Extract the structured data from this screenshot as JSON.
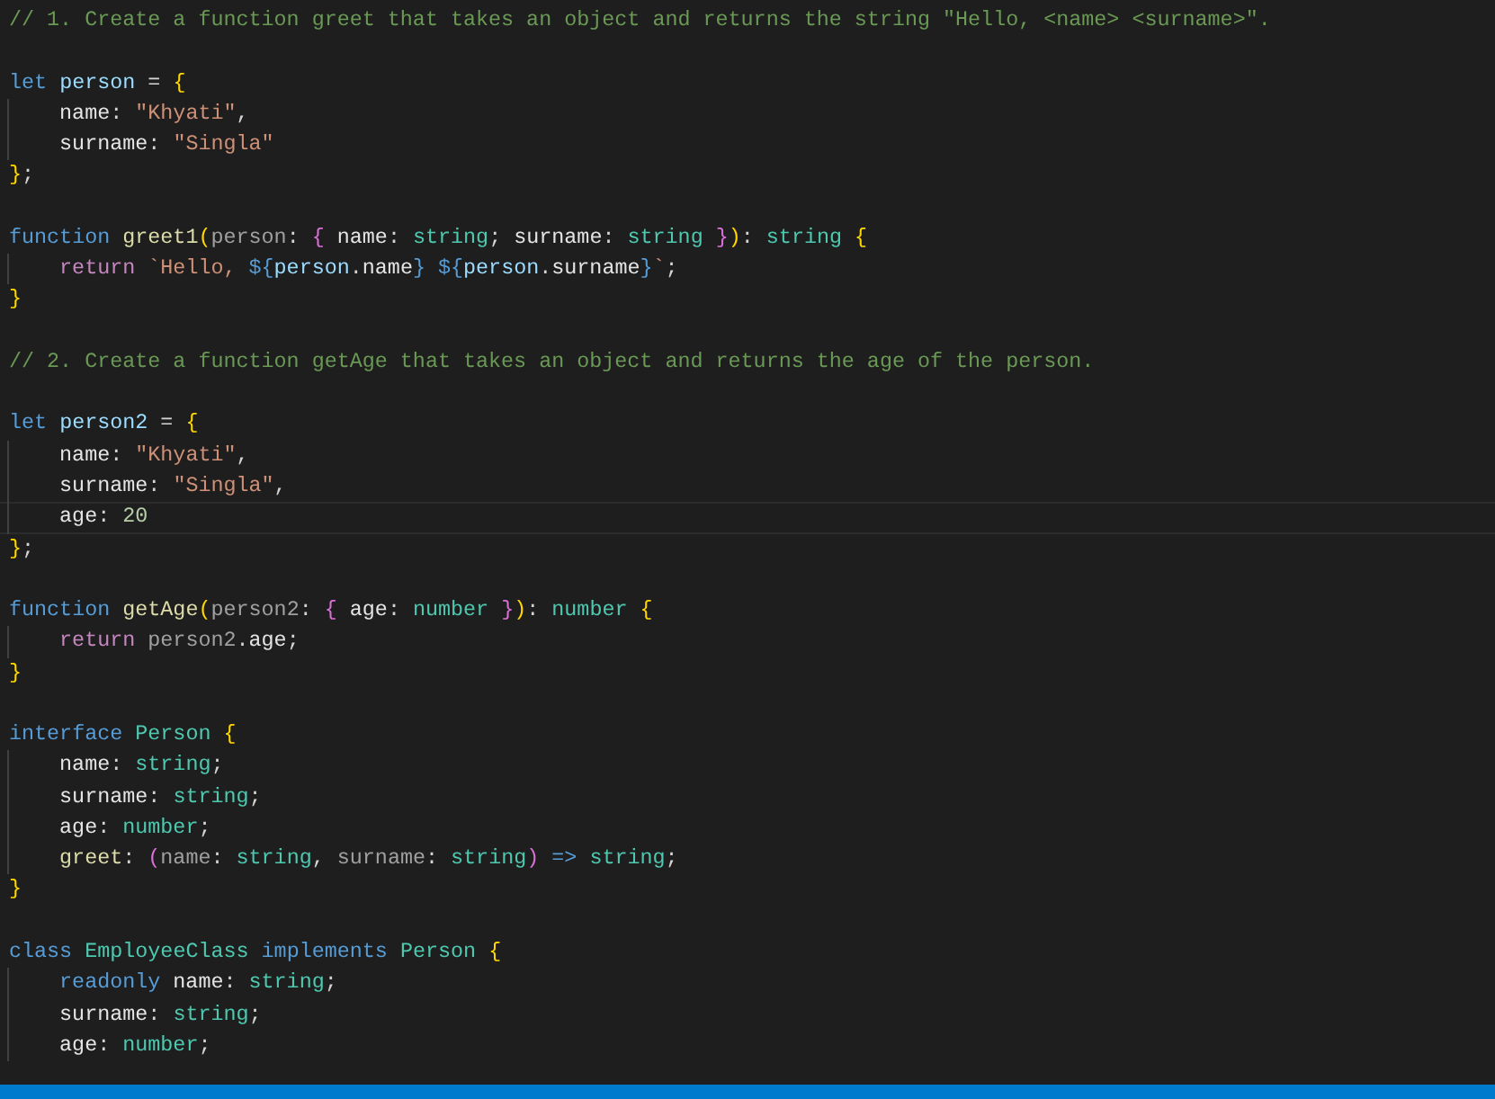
{
  "editor": {
    "lines": [
      {
        "kind": "code",
        "indented": false,
        "current": false,
        "tokens": [
          {
            "kind": "comment",
            "text": "// 1. Create a function greet that takes an object and returns the string \"Hello, <name> <surname>\"."
          }
        ]
      },
      {
        "kind": "blank"
      },
      {
        "kind": "code",
        "indented": false,
        "current": false,
        "tokens": [
          {
            "kind": "keyword",
            "text": "let "
          },
          {
            "kind": "variable",
            "text": "person"
          },
          {
            "kind": "punct",
            "text": " = "
          },
          {
            "kind": "bracket1",
            "text": "{"
          }
        ]
      },
      {
        "kind": "code",
        "indented": true,
        "current": false,
        "tokens": [
          {
            "kind": "property",
            "text": "name"
          },
          {
            "kind": "punct",
            "text": ": "
          },
          {
            "kind": "string",
            "text": "\"Khyati\""
          },
          {
            "kind": "punct",
            "text": ","
          }
        ]
      },
      {
        "kind": "code",
        "indented": true,
        "current": false,
        "tokens": [
          {
            "kind": "property",
            "text": "surname"
          },
          {
            "kind": "punct",
            "text": ": "
          },
          {
            "kind": "string",
            "text": "\"Singla\""
          }
        ]
      },
      {
        "kind": "code",
        "indented": false,
        "current": false,
        "tokens": [
          {
            "kind": "bracket1",
            "text": "}"
          },
          {
            "kind": "punct",
            "text": ";"
          }
        ]
      },
      {
        "kind": "blank"
      },
      {
        "kind": "code",
        "indented": false,
        "current": false,
        "tokens": [
          {
            "kind": "keyword",
            "text": "function "
          },
          {
            "kind": "function",
            "text": "greet1"
          },
          {
            "kind": "bracket1",
            "text": "("
          },
          {
            "kind": "param",
            "text": "person"
          },
          {
            "kind": "punct",
            "text": ": "
          },
          {
            "kind": "bracket2",
            "text": "{"
          },
          {
            "kind": "property",
            "text": " name"
          },
          {
            "kind": "punct",
            "text": ": "
          },
          {
            "kind": "type",
            "text": "string"
          },
          {
            "kind": "punct",
            "text": "; "
          },
          {
            "kind": "property",
            "text": "surname"
          },
          {
            "kind": "punct",
            "text": ": "
          },
          {
            "kind": "type",
            "text": "string "
          },
          {
            "kind": "bracket2",
            "text": "}"
          },
          {
            "kind": "bracket1",
            "text": ")"
          },
          {
            "kind": "punct",
            "text": ": "
          },
          {
            "kind": "type",
            "text": "string "
          },
          {
            "kind": "bracket1",
            "text": "{"
          }
        ]
      },
      {
        "kind": "code",
        "indented": true,
        "current": false,
        "tokens": [
          {
            "kind": "control",
            "text": "return "
          },
          {
            "kind": "string",
            "text": "`Hello, "
          },
          {
            "kind": "keyword",
            "text": "${"
          },
          {
            "kind": "variable",
            "text": "person"
          },
          {
            "kind": "punct",
            "text": "."
          },
          {
            "kind": "property",
            "text": "name"
          },
          {
            "kind": "keyword",
            "text": "} "
          },
          {
            "kind": "keyword",
            "text": "${"
          },
          {
            "kind": "variable",
            "text": "person"
          },
          {
            "kind": "punct",
            "text": "."
          },
          {
            "kind": "property",
            "text": "surname"
          },
          {
            "kind": "keyword",
            "text": "}"
          },
          {
            "kind": "string",
            "text": "`"
          },
          {
            "kind": "punct",
            "text": ";"
          }
        ]
      },
      {
        "kind": "code",
        "indented": false,
        "current": false,
        "tokens": [
          {
            "kind": "bracket1",
            "text": "}"
          }
        ]
      },
      {
        "kind": "blank"
      },
      {
        "kind": "code",
        "indented": false,
        "current": false,
        "tokens": [
          {
            "kind": "comment",
            "text": "// 2. Create a function getAge that takes an object and returns the age of the person."
          }
        ]
      },
      {
        "kind": "blank"
      },
      {
        "kind": "code",
        "indented": false,
        "current": false,
        "tokens": [
          {
            "kind": "keyword",
            "text": "let "
          },
          {
            "kind": "variable",
            "text": "person2"
          },
          {
            "kind": "punct",
            "text": " = "
          },
          {
            "kind": "bracket1",
            "text": "{"
          }
        ]
      },
      {
        "kind": "code",
        "indented": true,
        "current": false,
        "tokens": [
          {
            "kind": "property",
            "text": "name"
          },
          {
            "kind": "punct",
            "text": ": "
          },
          {
            "kind": "string",
            "text": "\"Khyati\""
          },
          {
            "kind": "punct",
            "text": ","
          }
        ]
      },
      {
        "kind": "code",
        "indented": true,
        "current": false,
        "tokens": [
          {
            "kind": "property",
            "text": "surname"
          },
          {
            "kind": "punct",
            "text": ": "
          },
          {
            "kind": "string",
            "text": "\"Singla\""
          },
          {
            "kind": "punct",
            "text": ","
          }
        ]
      },
      {
        "kind": "code",
        "indented": true,
        "current": true,
        "tokens": [
          {
            "kind": "property",
            "text": "age"
          },
          {
            "kind": "punct",
            "text": ": "
          },
          {
            "kind": "number",
            "text": "20"
          }
        ]
      },
      {
        "kind": "code",
        "indented": false,
        "current": false,
        "tokens": [
          {
            "kind": "bracket1",
            "text": "}"
          },
          {
            "kind": "punct",
            "text": ";"
          }
        ]
      },
      {
        "kind": "blank"
      },
      {
        "kind": "code",
        "indented": false,
        "current": false,
        "tokens": [
          {
            "kind": "keyword",
            "text": "function "
          },
          {
            "kind": "function",
            "text": "getAge"
          },
          {
            "kind": "bracket1",
            "text": "("
          },
          {
            "kind": "param",
            "text": "person2"
          },
          {
            "kind": "punct",
            "text": ": "
          },
          {
            "kind": "bracket2",
            "text": "{"
          },
          {
            "kind": "property",
            "text": " age"
          },
          {
            "kind": "punct",
            "text": ": "
          },
          {
            "kind": "type",
            "text": "number "
          },
          {
            "kind": "bracket2",
            "text": "}"
          },
          {
            "kind": "bracket1",
            "text": ")"
          },
          {
            "kind": "punct",
            "text": ": "
          },
          {
            "kind": "type",
            "text": "number "
          },
          {
            "kind": "bracket1",
            "text": "{"
          }
        ]
      },
      {
        "kind": "code",
        "indented": true,
        "current": false,
        "tokens": [
          {
            "kind": "control",
            "text": "return "
          },
          {
            "kind": "param",
            "text": "person2"
          },
          {
            "kind": "punct",
            "text": "."
          },
          {
            "kind": "property",
            "text": "age"
          },
          {
            "kind": "punct",
            "text": ";"
          }
        ]
      },
      {
        "kind": "code",
        "indented": false,
        "current": false,
        "tokens": [
          {
            "kind": "bracket1",
            "text": "}"
          }
        ]
      },
      {
        "kind": "blank"
      },
      {
        "kind": "code",
        "indented": false,
        "current": false,
        "tokens": [
          {
            "kind": "keyword",
            "text": "interface "
          },
          {
            "kind": "type",
            "text": "Person "
          },
          {
            "kind": "bracket1",
            "text": "{"
          }
        ]
      },
      {
        "kind": "code",
        "indented": true,
        "current": false,
        "tokens": [
          {
            "kind": "property",
            "text": "name"
          },
          {
            "kind": "punct",
            "text": ": "
          },
          {
            "kind": "type",
            "text": "string"
          },
          {
            "kind": "punct",
            "text": ";"
          }
        ]
      },
      {
        "kind": "code",
        "indented": true,
        "current": false,
        "tokens": [
          {
            "kind": "property",
            "text": "surname"
          },
          {
            "kind": "punct",
            "text": ": "
          },
          {
            "kind": "type",
            "text": "string"
          },
          {
            "kind": "punct",
            "text": ";"
          }
        ]
      },
      {
        "kind": "code",
        "indented": true,
        "current": false,
        "tokens": [
          {
            "kind": "property",
            "text": "age"
          },
          {
            "kind": "punct",
            "text": ": "
          },
          {
            "kind": "type",
            "text": "number"
          },
          {
            "kind": "punct",
            "text": ";"
          }
        ]
      },
      {
        "kind": "code",
        "indented": true,
        "current": false,
        "tokens": [
          {
            "kind": "function",
            "text": "greet"
          },
          {
            "kind": "punct",
            "text": ": "
          },
          {
            "kind": "bracket2",
            "text": "("
          },
          {
            "kind": "param",
            "text": "name"
          },
          {
            "kind": "punct",
            "text": ": "
          },
          {
            "kind": "type",
            "text": "string"
          },
          {
            "kind": "punct",
            "text": ", "
          },
          {
            "kind": "param",
            "text": "surname"
          },
          {
            "kind": "punct",
            "text": ": "
          },
          {
            "kind": "type",
            "text": "string"
          },
          {
            "kind": "bracket2",
            "text": ")"
          },
          {
            "kind": "keyword",
            "text": " => "
          },
          {
            "kind": "type",
            "text": "string"
          },
          {
            "kind": "punct",
            "text": ";"
          }
        ]
      },
      {
        "kind": "code",
        "indented": false,
        "current": false,
        "tokens": [
          {
            "kind": "bracket1",
            "text": "}"
          }
        ]
      },
      {
        "kind": "blank"
      },
      {
        "kind": "code",
        "indented": false,
        "current": false,
        "tokens": [
          {
            "kind": "keyword",
            "text": "class "
          },
          {
            "kind": "type",
            "text": "EmployeeClass "
          },
          {
            "kind": "keyword",
            "text": "implements "
          },
          {
            "kind": "type",
            "text": "Person "
          },
          {
            "kind": "bracket1",
            "text": "{"
          }
        ]
      },
      {
        "kind": "code",
        "indented": true,
        "current": false,
        "tokens": [
          {
            "kind": "keyword",
            "text": "readonly "
          },
          {
            "kind": "property",
            "text": "name"
          },
          {
            "kind": "punct",
            "text": ": "
          },
          {
            "kind": "type",
            "text": "string"
          },
          {
            "kind": "punct",
            "text": ";"
          }
        ]
      },
      {
        "kind": "code",
        "indented": true,
        "current": false,
        "tokens": [
          {
            "kind": "property",
            "text": "surname"
          },
          {
            "kind": "punct",
            "text": ": "
          },
          {
            "kind": "type",
            "text": "string"
          },
          {
            "kind": "punct",
            "text": ";"
          }
        ]
      },
      {
        "kind": "code",
        "indented": true,
        "current": false,
        "tokens": [
          {
            "kind": "property",
            "text": "age"
          },
          {
            "kind": "punct",
            "text": ": "
          },
          {
            "kind": "type",
            "text": "number"
          },
          {
            "kind": "punct",
            "text": ";"
          }
        ]
      }
    ]
  }
}
